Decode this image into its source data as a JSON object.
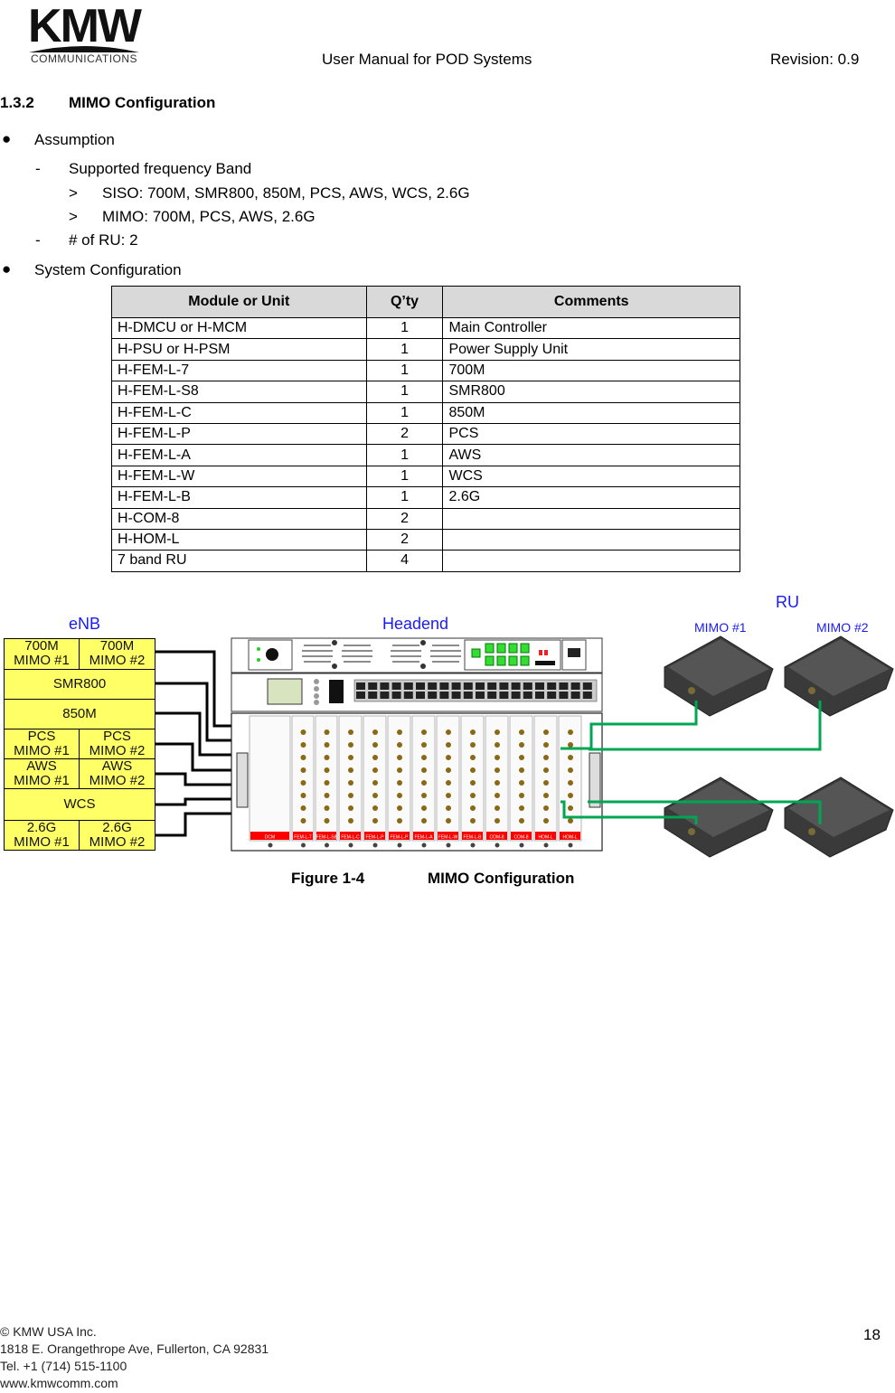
{
  "header": {
    "logo_text": "KMW",
    "logo_subtext": "COMMUNICATIONS",
    "title": "User Manual for POD Systems",
    "revision": "Revision: 0.9"
  },
  "section": {
    "number": "1.3.2",
    "title": "MIMO Configuration"
  },
  "assumption": {
    "label": "Assumption",
    "items": [
      {
        "dash": "-",
        "text": "Supported frequency Band",
        "sub": [
          {
            "marker": ">",
            "text": "SISO: 700M, SMR800, 850M, PCS, AWS, WCS, 2.6G"
          },
          {
            "marker": ">",
            "text": "MIMO: 700M, PCS, AWS, 2.6G"
          }
        ]
      },
      {
        "dash": "-",
        "text": "# of RU: 2"
      }
    ]
  },
  "system_configuration": {
    "label": "System Configuration",
    "columns": [
      "Module or Unit",
      "Q’ty",
      "Comments"
    ],
    "rows": [
      [
        "H-DMCU or H-MCM",
        "1",
        "Main Controller"
      ],
      [
        "H-PSU or H-PSM",
        "1",
        "Power Supply Unit"
      ],
      [
        "H-FEM-L-7",
        "1",
        "700M"
      ],
      [
        "H-FEM-L-S8",
        "1",
        "SMR800"
      ],
      [
        "H-FEM-L-C",
        "1",
        "850M"
      ],
      [
        "H-FEM-L-P",
        "2",
        "PCS"
      ],
      [
        "H-FEM-L-A",
        "1",
        "AWS"
      ],
      [
        "H-FEM-L-W",
        "1",
        "WCS"
      ],
      [
        "H-FEM-L-B",
        "1",
        "2.6G"
      ],
      [
        "H-COM-8",
        "2",
        ""
      ],
      [
        "H-HOM-L",
        "2",
        ""
      ],
      [
        "7 band RU",
        "4",
        ""
      ]
    ]
  },
  "figure": {
    "labels": {
      "enb": "eNB",
      "headend": "Headend",
      "ru": "RU",
      "ru_mimo1": "MIMO #1",
      "ru_mimo2": "MIMO #2"
    },
    "enb_cells": [
      {
        "line1": "700M",
        "line2": "MIMO #1"
      },
      {
        "line1": "700M",
        "line2": "MIMO #2"
      },
      {
        "line1": "SMR800",
        "line2": ""
      },
      {
        "line1": "850M",
        "line2": ""
      },
      {
        "line1": "PCS",
        "line2": "MIMO #1"
      },
      {
        "line1": "PCS",
        "line2": "MIMO #2"
      },
      {
        "line1": "AWS",
        "line2": "MIMO #1"
      },
      {
        "line1": "AWS",
        "line2": "MIMO #2"
      },
      {
        "line1": "WCS",
        "line2": ""
      },
      {
        "line1": "2.6G",
        "line2": "MIMO #1"
      },
      {
        "line1": "2.6G",
        "line2": "MIMO #2"
      }
    ],
    "module_slots": [
      "DCM",
      "FEM-L-7",
      "FEM-L-S8",
      "FEM-L-C",
      "FEM-L-P",
      "FEM-L-P",
      "FEM-L-A",
      "FEM-L-W",
      "FEM-L-B",
      "COM-8",
      "COM-8",
      "HOM-L",
      "HOM-L"
    ],
    "colors": {
      "enb_fill": "#ffff66",
      "label_blue": "#1a1aff",
      "fiber_green": "#00a651",
      "slot_red": "#ff0000",
      "port_green": "#22dd22",
      "ru_body": "#3a3a3a"
    },
    "caption_number": "Figure 1-4",
    "caption_title": "MIMO Configuration"
  },
  "footer": {
    "copyright": "© KMW USA Inc.",
    "address": "1818 E. Orangethrope Ave, Fullerton, CA 92831",
    "tel": "Tel. +1 (714) 515-1100",
    "web": "www.kmwcomm.com",
    "page_number": "18"
  }
}
